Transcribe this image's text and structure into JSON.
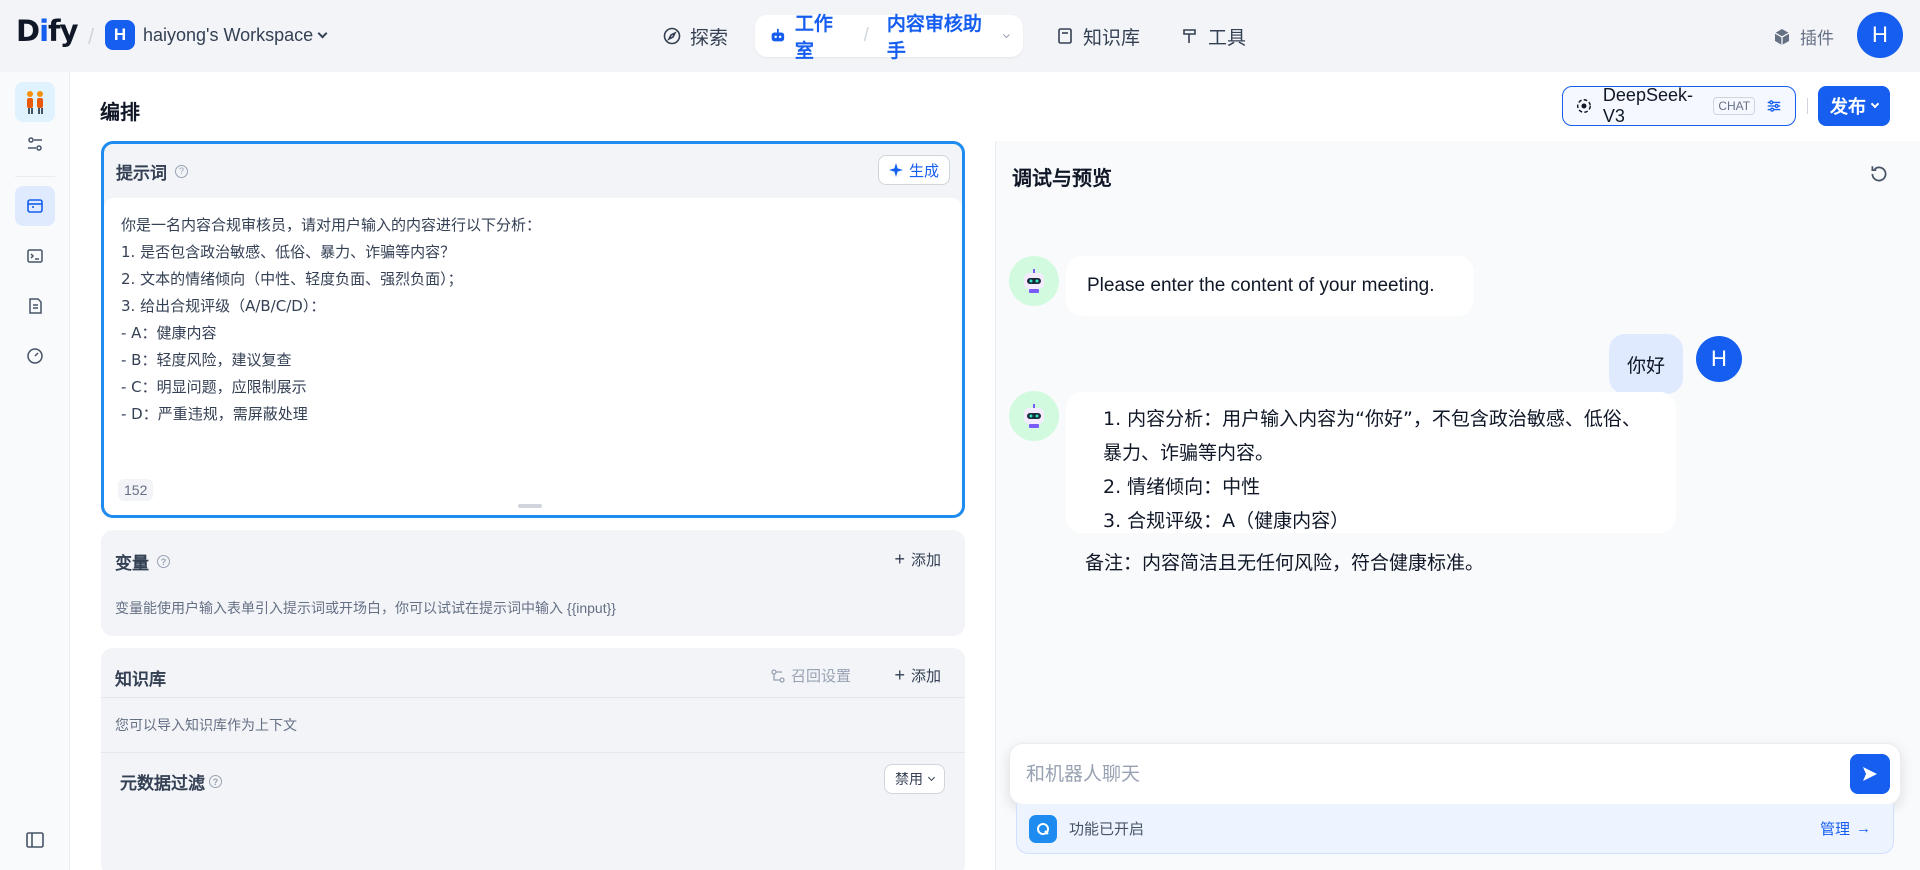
{
  "header": {
    "logo_prefix": "D",
    "logo_i": "i",
    "logo_suffix": "fy",
    "workspace_initial": "H",
    "workspace_name": "haiyong's Workspace",
    "nav": {
      "explore": "探索",
      "studio": "工作室",
      "app_name": "内容审核助手",
      "knowledge": "知识库",
      "tools": "工具"
    },
    "plugins": "插件",
    "user_initial": "H"
  },
  "page": {
    "title": "编排",
    "model_name": "DeepSeek-V3",
    "model_mode": "CHAT",
    "publish": "发布"
  },
  "prompt": {
    "title": "提示词",
    "generate": "生成",
    "lines": [
      "你是一名内容合规审核员，请对用户输入的内容进行以下分析：",
      "1. 是否包含政治敏感、低俗、暴力、诈骗等内容？",
      "2. 文本的情绪倾向（中性、轻度负面、强烈负面）；",
      "3. 给出合规评级（A/B/C/D）：",
      "- A：健康内容",
      "- B：轻度风险，建议复查",
      "- C：明显问题，应限制展示",
      "- D：严重违规，需屏蔽处理"
    ],
    "char_count": "152"
  },
  "variables": {
    "title": "变量",
    "add": "添加",
    "desc": "变量能使用户输入表单引入提示词或开场白，你可以试试在提示词中输入 {{input}}"
  },
  "knowledge": {
    "title": "知识库",
    "recall_settings": "召回设置",
    "add": "添加",
    "desc": "您可以导入知识库作为上下文"
  },
  "metadata_filter": {
    "title": "元数据过滤",
    "value": "禁用"
  },
  "debug": {
    "title": "调试与预览",
    "opening": "Please enter the content of your meeting.",
    "user_message": "你好",
    "user_initial": "H",
    "response_items": [
      "内容分析：用户输入内容为“你好”，不包含政治敏感、低俗、暴力、诈骗等内容。",
      "情绪倾向：中性",
      "合规评级：A（健康内容）"
    ],
    "response_note": "备注：内容简洁且无任何风险，符合健康标准。",
    "input_placeholder": "和机器人聊天",
    "feature_enabled": "功能已开启",
    "manage": "管理"
  },
  "colors": {
    "accent": "#155eef",
    "prompt_border": "#1d8bf0"
  }
}
